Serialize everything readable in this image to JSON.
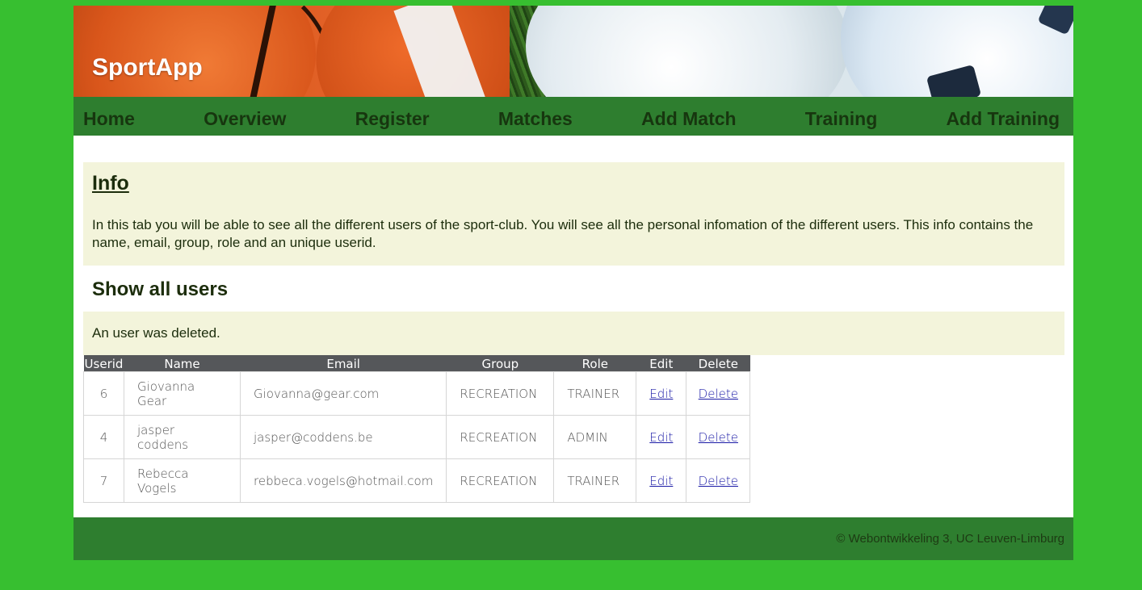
{
  "app": {
    "title": "SportApp"
  },
  "nav": {
    "items": [
      "Home",
      "Overview",
      "Register",
      "Matches",
      "Add Match",
      "Training",
      "Add Training"
    ]
  },
  "info": {
    "heading": "Info",
    "text": "In this tab you will be able to see all the different users of the sport-club. You will see all the personal infomation of the different users. This info contains the name, email, group, role and an unique userid."
  },
  "section": {
    "heading": "Show all users"
  },
  "status": {
    "message": "An user was deleted."
  },
  "table": {
    "headers": [
      "Userid",
      "Name",
      "Email",
      "Group",
      "Role",
      "Edit",
      "Delete"
    ],
    "rows": [
      {
        "userid": "6",
        "name": "Giovanna Gear",
        "email": "Giovanna@gear.com",
        "group": "RECREATION",
        "role": "TRAINER",
        "edit": "Edit",
        "delete": "Delete"
      },
      {
        "userid": "4",
        "name": "jasper coddens",
        "email": "jasper@coddens.be",
        "group": "RECREATION",
        "role": "ADMIN",
        "edit": "Edit",
        "delete": "Delete"
      },
      {
        "userid": "7",
        "name": "Rebecca Vogels",
        "email": "rebbeca.vogels@hotmail.com",
        "group": "RECREATION",
        "role": "TRAINER",
        "edit": "Edit",
        "delete": "Delete"
      }
    ]
  },
  "footer": {
    "text": "© Webontwikkeling 3, UC Leuven-Limburg"
  },
  "colors": {
    "page_bg": "#37bf30",
    "nav_bg": "#2e7e2f",
    "panel_bg": "#f3f4db",
    "table_header_bg": "#55575a",
    "link": "#1a1aa6"
  }
}
